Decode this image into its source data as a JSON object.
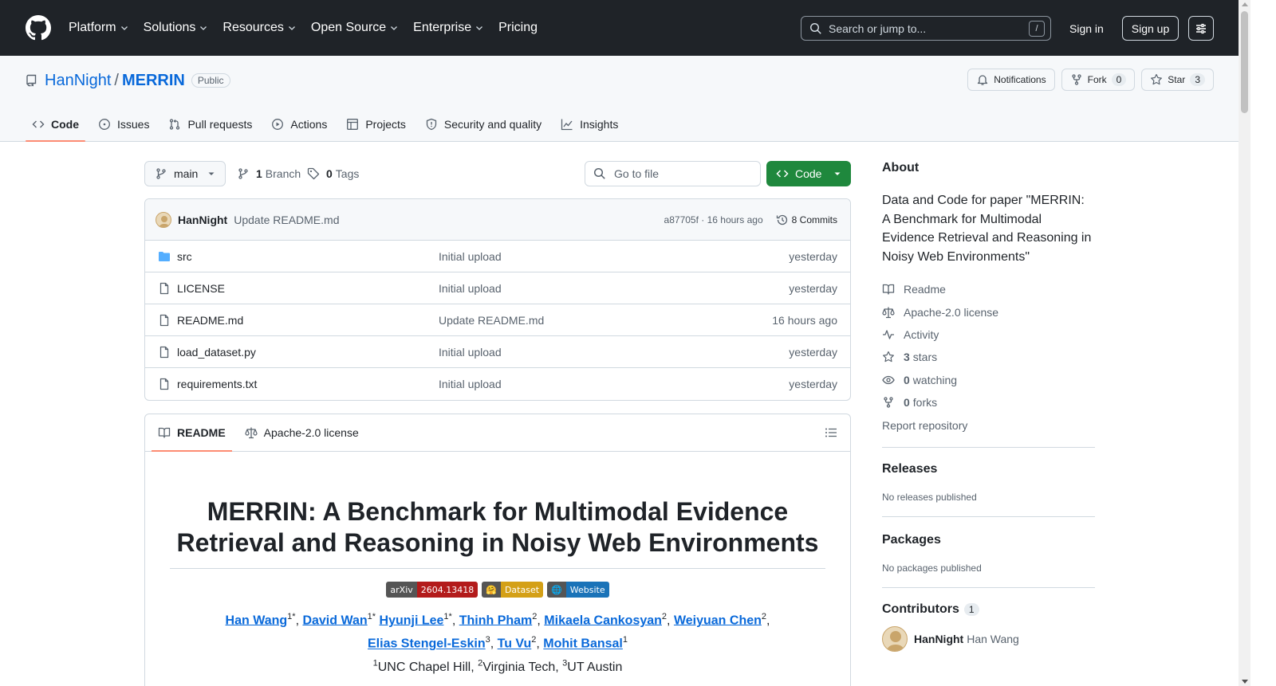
{
  "header": {
    "nav": [
      {
        "label": "Platform",
        "dropdown": true
      },
      {
        "label": "Solutions",
        "dropdown": true
      },
      {
        "label": "Resources",
        "dropdown": true
      },
      {
        "label": "Open Source",
        "dropdown": true
      },
      {
        "label": "Enterprise",
        "dropdown": true
      },
      {
        "label": "Pricing",
        "dropdown": false
      }
    ],
    "search_placeholder": "Search or jump to...",
    "search_shortcut": "/",
    "sign_in": "Sign in",
    "sign_up": "Sign up"
  },
  "repo": {
    "owner": "HanNight",
    "separator": "/",
    "name": "MERRIN",
    "visibility": "Public",
    "notifications_label": "Notifications",
    "fork_label": "Fork",
    "fork_count": "0",
    "star_label": "Star",
    "star_count": "3",
    "tabs": [
      {
        "label": "Code",
        "icon": "code-icon",
        "active": true
      },
      {
        "label": "Issues",
        "icon": "issue-icon",
        "active": false
      },
      {
        "label": "Pull requests",
        "icon": "pull-request-icon",
        "active": false
      },
      {
        "label": "Actions",
        "icon": "play-icon",
        "active": false
      },
      {
        "label": "Projects",
        "icon": "table-icon",
        "active": false
      },
      {
        "label": "Security and quality",
        "icon": "shield-icon",
        "active": false
      },
      {
        "label": "Insights",
        "icon": "graph-icon",
        "active": false
      }
    ]
  },
  "toolbar": {
    "branch": "main",
    "branch_count": "1",
    "branch_label": "Branch",
    "tag_count": "0",
    "tag_label": "Tags",
    "goto_placeholder": "Go to file",
    "code_label": "Code"
  },
  "commit": {
    "user": "HanNight",
    "message": "Update README.md",
    "sha_time": "a87705f · 16 hours ago",
    "count_label": "8 Commits"
  },
  "files": [
    {
      "name": "src",
      "type": "folder",
      "message": "Initial upload",
      "time": "yesterday"
    },
    {
      "name": "LICENSE",
      "type": "file",
      "message": "Initial upload",
      "time": "yesterday"
    },
    {
      "name": "README.md",
      "type": "file",
      "message": "Update README.md",
      "time": "16 hours ago"
    },
    {
      "name": "load_dataset.py",
      "type": "file",
      "message": "Initial upload",
      "time": "yesterday"
    },
    {
      "name": "requirements.txt",
      "type": "file",
      "message": "Initial upload",
      "time": "yesterday"
    }
  ],
  "readme": {
    "tab_readme": "README",
    "tab_license": "Apache-2.0 license",
    "title_line1": "MERRIN: A Benchmark for Multimodal Evidence",
    "title_line2": "Retrieval and Reasoning in Noisy Web Environments",
    "badges": [
      {
        "left": "arXiv",
        "right": "2604.13418",
        "left_color": "#555555",
        "right_color": "#b31b1b"
      },
      {
        "left": "🤗",
        "right": "Dataset",
        "left_color": "#555555",
        "right_color": "#d4a017"
      },
      {
        "left": "🌐",
        "right": "Website",
        "left_color": "#555555",
        "right_color": "#1a73b8"
      }
    ],
    "authors": [
      {
        "name": "Han Wang",
        "sup": "1*"
      },
      {
        "name": "David Wan",
        "sup": "1*"
      },
      {
        "name": "Hyunji Lee",
        "sup": "1*"
      },
      {
        "name": "Thinh Pham",
        "sup": "2"
      },
      {
        "name": "Mikaela Cankosyan",
        "sup": "2"
      },
      {
        "name": "Weiyuan Chen",
        "sup": "2"
      },
      {
        "name": "Elias Stengel-Eskin",
        "sup": "3"
      },
      {
        "name": "Tu Vu",
        "sup": "2"
      },
      {
        "name": "Mohit Bansal",
        "sup": "1"
      }
    ],
    "affiliations": [
      {
        "sup": "1",
        "name": "UNC Chapel Hill"
      },
      {
        "sup": "2",
        "name": "Virginia Tech"
      },
      {
        "sup": "3",
        "name": "UT Austin"
      }
    ]
  },
  "sidebar": {
    "about_title": "About",
    "description": "Data and Code for paper \"MERRIN: A Benchmark for Multimodal Evidence Retrieval and Reasoning in Noisy Web Environments\"",
    "readme": "Readme",
    "license": "Apache-2.0 license",
    "activity": "Activity",
    "stars_count": "3",
    "stars_label": "stars",
    "watching_count": "0",
    "watching_label": "watching",
    "forks_count": "0",
    "forks_label": "forks",
    "report": "Report repository",
    "releases_title": "Releases",
    "releases_empty": "No releases published",
    "packages_title": "Packages",
    "packages_empty": "No packages published",
    "contributors_title": "Contributors",
    "contributors_count": "1",
    "contributor_login": "HanNight",
    "contributor_name": "Han Wang"
  },
  "colors": {
    "header_bg": "#1f2328",
    "link": "#0969da",
    "primary_button": "#1f883d",
    "tab_underline": "#fd8c73"
  }
}
